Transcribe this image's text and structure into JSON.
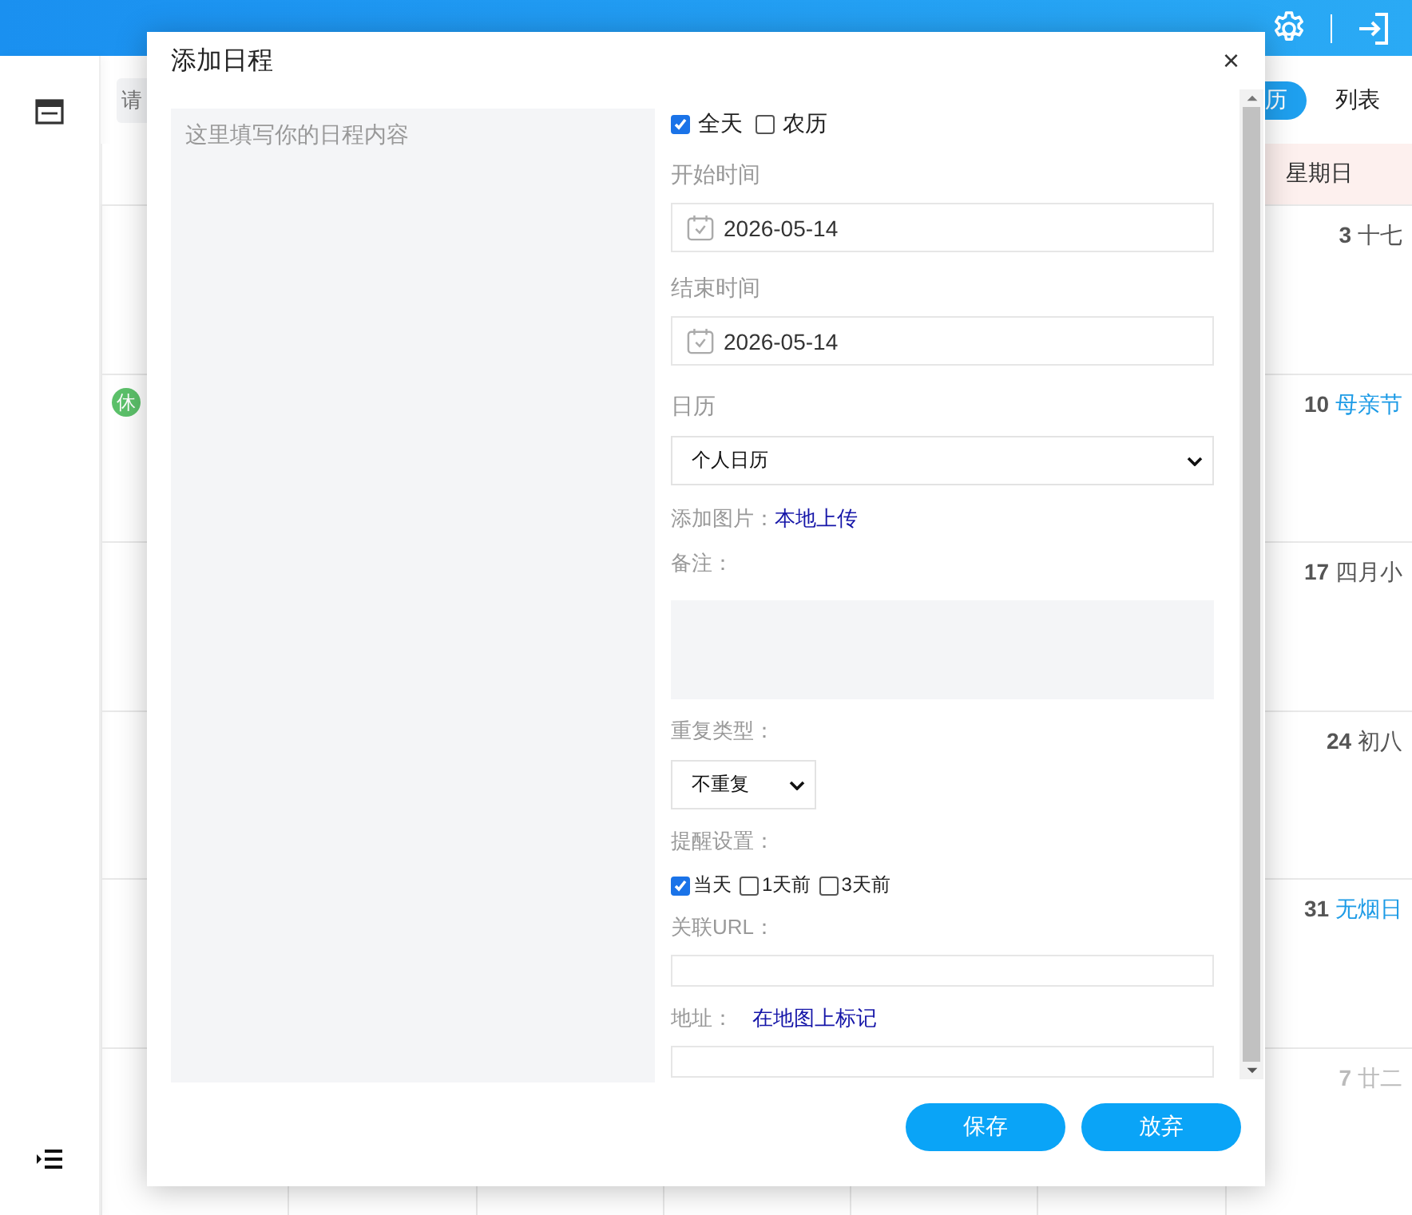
{
  "toolbar": {
    "search": {
      "placeholder": "请"
    },
    "view_tabs": [
      {
        "label": "历",
        "selected": true
      },
      {
        "label": "列表",
        "selected": false
      }
    ]
  },
  "calendar": {
    "header": "星期日",
    "rows": [
      {
        "day": "3",
        "note": "十七",
        "festival": false,
        "other_month": false
      },
      {
        "badge": "休",
        "day": "10",
        "note": "母亲节",
        "festival": true,
        "other_month": false
      },
      {
        "day": "17",
        "note": "四月小",
        "festival": false,
        "other_month": false
      },
      {
        "day": "24",
        "note": "初八",
        "festival": false,
        "other_month": false
      },
      {
        "day": "31",
        "note": "无烟日",
        "festival": true,
        "other_month": false
      },
      {
        "day": "7",
        "note": "廿二",
        "festival": false,
        "other_month": true
      }
    ]
  },
  "dialog": {
    "title": "添加日程",
    "close": "×",
    "content": {
      "placeholder": "这里填写你的日程内容"
    },
    "options": [
      {
        "label": "全天",
        "checked": true
      },
      {
        "label": "农历",
        "checked": false
      }
    ],
    "start": {
      "label": "开始时间",
      "value": "2026-05-14"
    },
    "end": {
      "label": "结束时间",
      "value": "2026-05-14"
    },
    "calendar": {
      "label": "日历",
      "value": "个人日历"
    },
    "image": {
      "label": "添加图片：",
      "link": "本地上传"
    },
    "remark": {
      "label": "备注："
    },
    "repeat": {
      "label": "重复类型：",
      "value": "不重复"
    },
    "reminder": {
      "label": "提醒设置：",
      "options": [
        {
          "label": "当天",
          "checked": true
        },
        {
          "label": "1天前",
          "checked": false
        },
        {
          "label": "3天前",
          "checked": false
        }
      ]
    },
    "url": {
      "label": "关联URL："
    },
    "address": {
      "label": "地址：",
      "link": "在地图上标记"
    },
    "buttons": [
      "保存",
      "放弃"
    ]
  }
}
